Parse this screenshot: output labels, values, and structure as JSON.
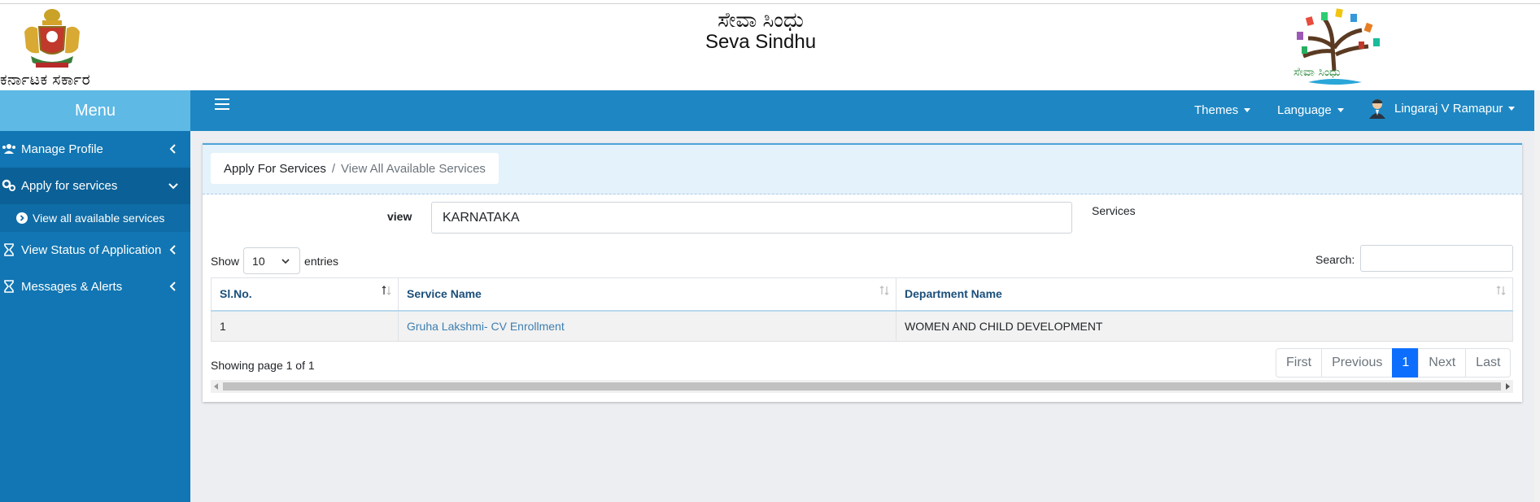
{
  "header": {
    "gov_text": "ಕರ್ನಾಟಕ ಸರ್ಕಾರ",
    "title_kannada": "ಸೇವಾ ಸಿಂಧು",
    "title_english": "Seva Sindhu",
    "logo_text": "ಸೇವಾ ಸಿಂಧು"
  },
  "sidebar": {
    "menu_title": "Menu",
    "items": [
      {
        "label": "Manage Profile",
        "icon": "users-icon"
      },
      {
        "label": "Apply for services",
        "icon": "gears-icon"
      },
      {
        "label": "View all available services",
        "icon": "chevron-circle-icon"
      },
      {
        "label": "View Status of Application",
        "icon": "hourglass-icon"
      },
      {
        "label": "Messages & Alerts",
        "icon": "hourglass-icon"
      }
    ]
  },
  "topbar": {
    "themes": "Themes",
    "language": "Language",
    "user": "Lingaraj V Ramapur"
  },
  "breadcrumb": {
    "parent": "Apply For Services",
    "current": "View All Available Services"
  },
  "filter": {
    "view_label": "view",
    "view_value": "KARNATAKA",
    "services_label": "Services"
  },
  "table_controls": {
    "show": "Show",
    "entries_value": "10",
    "entries": "entries",
    "search": "Search:"
  },
  "table": {
    "headers": [
      "Sl.No.",
      "Service Name",
      "Department Name"
    ],
    "rows": [
      [
        "1",
        "Gruha Lakshmi- CV Enrollment",
        "WOMEN AND CHILD DEVELOPMENT"
      ]
    ]
  },
  "footer": {
    "info": "Showing page 1 of 1",
    "pager": [
      "First",
      "Previous",
      "1",
      "Next",
      "Last"
    ]
  },
  "colors": {
    "sidebar": "#1176b3",
    "menu_header": "#5eb9e5",
    "topbar": "#1e87c3",
    "active_page": "#0d6efd"
  }
}
